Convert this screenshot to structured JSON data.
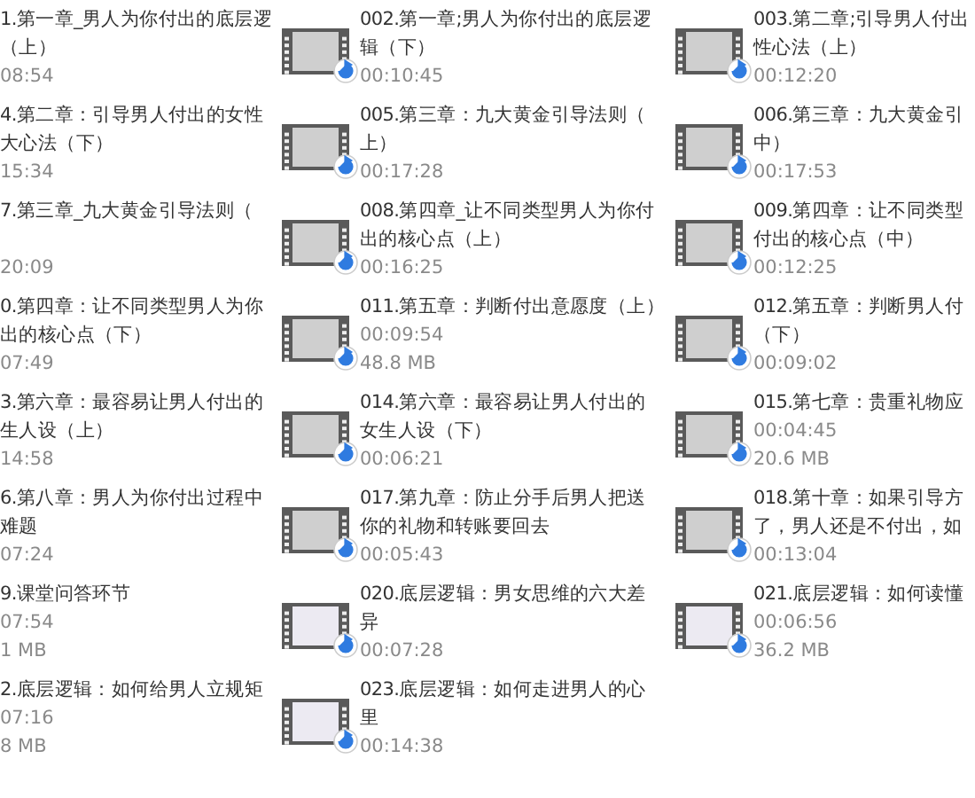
{
  "files": [
    {
      "title": [
        "1.第一章_男人为你付出的底层逻",
        "（上）"
      ],
      "time": "08:54",
      "kind": "text-only"
    },
    {
      "title": [
        "002.第一章;男人为你付出的底层逻",
        "辑（下）"
      ],
      "time": "00:10:45",
      "kind": "video"
    },
    {
      "title": [
        "003.第二章;引导男人付出",
        "性心法（上）"
      ],
      "time": "00:12:20",
      "kind": "video"
    },
    {
      "title": [
        "4.第二章：引导男人付出的女性",
        "大心法（下）"
      ],
      "time": "15:34",
      "kind": "text-only"
    },
    {
      "title": [
        "005.第三章：九大黄金引导法则（",
        "上）"
      ],
      "time": "00:17:28",
      "kind": "video"
    },
    {
      "title": [
        "006.第三章：九大黄金引",
        "中）"
      ],
      "time": "00:17:53",
      "kind": "video"
    },
    {
      "title": [
        "7.第三章_九大黄金引导法则（"
      ],
      "time": "20:09",
      "kind": "text-only"
    },
    {
      "title": [
        "008.第四章_让不同类型男人为你付",
        "出的核心点（上）"
      ],
      "time": "00:16:25",
      "kind": "video"
    },
    {
      "title": [
        "009.第四章：让不同类型",
        "付出的核心点（中）"
      ],
      "time": "00:12:25",
      "kind": "video"
    },
    {
      "title": [
        "0.第四章：让不同类型男人为你",
        "出的核心点（下）"
      ],
      "time": "07:49",
      "kind": "text-only"
    },
    {
      "title": [
        "011.第五章：判断付出意愿度（上）"
      ],
      "time": "00:09:54",
      "size": "48.8 MB",
      "kind": "video"
    },
    {
      "title": [
        "012.第五章：判断男人付",
        "（下）"
      ],
      "time": "00:09:02",
      "kind": "video"
    },
    {
      "title": [
        "3.第六章：最容易让男人付出的",
        "生人设（上）"
      ],
      "time": "14:58",
      "kind": "text-only"
    },
    {
      "title": [
        "014.第六章：最容易让男人付出的",
        "女生人设（下）"
      ],
      "time": "00:06:21",
      "kind": "video"
    },
    {
      "title": [
        "015.第七章：贵重礼物应"
      ],
      "time": "00:04:45",
      "size": "20.6 MB",
      "kind": "video"
    },
    {
      "title": [
        "6.第八章：男人为你付出过程中",
        "难题"
      ],
      "time": "07:24",
      "kind": "text-only"
    },
    {
      "title": [
        "017.第九章：防止分手后男人把送",
        "你的礼物和转账要回去"
      ],
      "time": "00:05:43",
      "kind": "video"
    },
    {
      "title": [
        "018.第十章：如果引导方",
        "了，男人还是不付出，如"
      ],
      "time": "00:13:04",
      "kind": "video"
    },
    {
      "title": [
        "9.课堂问答环节"
      ],
      "time": "07:54",
      "size": "1 MB",
      "kind": "text-only"
    },
    {
      "title": [
        "020.底层逻辑：男女思维的六大差",
        "异"
      ],
      "time": "00:07:28",
      "kind": "video-light"
    },
    {
      "title": [
        "021.底层逻辑：如何读懂"
      ],
      "time": "00:06:56",
      "size": "36.2 MB",
      "kind": "video-light"
    },
    {
      "title": [
        "2.底层逻辑：如何给男人立规矩"
      ],
      "time": "07:16",
      "size": "8 MB",
      "kind": "text-only"
    },
    {
      "title": [
        "023.底层逻辑：如何走进男人的心",
        "里"
      ],
      "time": "00:14:38",
      "kind": "video-light"
    }
  ]
}
